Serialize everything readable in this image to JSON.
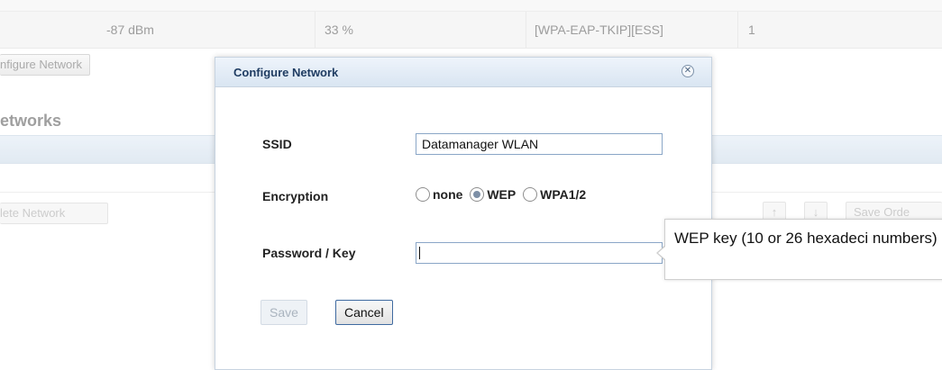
{
  "background": {
    "top_row_cells": [
      "-87 dBm",
      "33 %",
      "[WPA-EAP-TKIP][ESS]",
      "1"
    ],
    "configure_button": "nfigure Network",
    "networks_heading": "etworks",
    "delete_button": "lete Network",
    "up_arrow": "↑",
    "down_arrow": "↓",
    "save_order_button": "Save Orde"
  },
  "dialog": {
    "title": "Configure Network",
    "close_glyph": "✕",
    "ssid_label": "SSID",
    "ssid_value": "Datamanager WLAN",
    "encryption_label": "Encryption",
    "encryption_options": [
      "none",
      "WEP",
      "WPA1/2"
    ],
    "encryption_selected": "WEP",
    "password_label": "Password / Key",
    "password_value": "",
    "save_label": "Save",
    "cancel_label": "Cancel"
  },
  "tooltip": {
    "text": "WEP key (10 or 26 hexadeci numbers)"
  },
  "colors": {
    "dialog_header": "#d9e5f2",
    "title_text": "#1f3c62",
    "input_border": "#8aa6c7",
    "cancel_border": "#3f6aa0"
  }
}
